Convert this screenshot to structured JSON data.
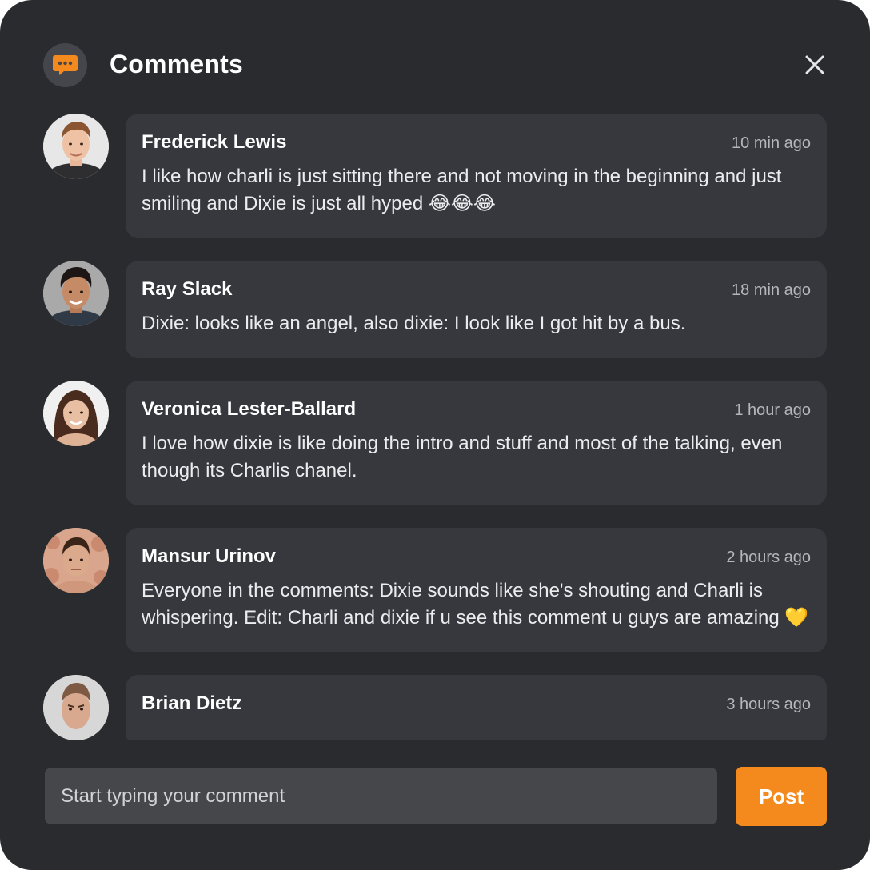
{
  "header": {
    "title": "Comments",
    "icon": "chat-bubble-icon",
    "close_icon": "close-icon"
  },
  "comments": [
    {
      "author": "Frederick Lewis",
      "time": "10 min ago",
      "text": "I like how charli is just sitting there and not moving in the beginning and just smiling and Dixie is just all hyped 😂😂😂",
      "avatar": "avatar-frederick-lewis"
    },
    {
      "author": "Ray Slack",
      "time": "18 min ago",
      "text": "Dixie: looks like an angel, also dixie: I look like I got hit by a bus.",
      "avatar": "avatar-ray-slack"
    },
    {
      "author": "Veronica Lester-Ballard",
      "time": "1 hour ago",
      "text": "I love how dixie is like doing the intro and stuff and most of the talking, even though its Charlis chanel.",
      "avatar": "avatar-veronica-lester-ballard"
    },
    {
      "author": "Mansur Urinov",
      "time": "2 hours ago",
      "text": "Everyone in the comments: Dixie sounds like she's shouting and Charli is whispering. Edit: Charli and dixie if u see this comment u guys are amazing 💛",
      "avatar": "avatar-mansur-urinov"
    },
    {
      "author": "Brian Dietz",
      "time": "3 hours ago",
      "text": "",
      "avatar": "avatar-brian-dietz"
    }
  ],
  "composer": {
    "placeholder": "Start typing your comment",
    "value": "",
    "post_label": "Post"
  },
  "colors": {
    "panel_bg": "#2a2b2f",
    "bubble_bg": "#36383d",
    "input_bg": "#46474b",
    "accent": "#f48a1e",
    "text_primary": "#ffffff",
    "text_secondary": "#b5b6ba"
  }
}
